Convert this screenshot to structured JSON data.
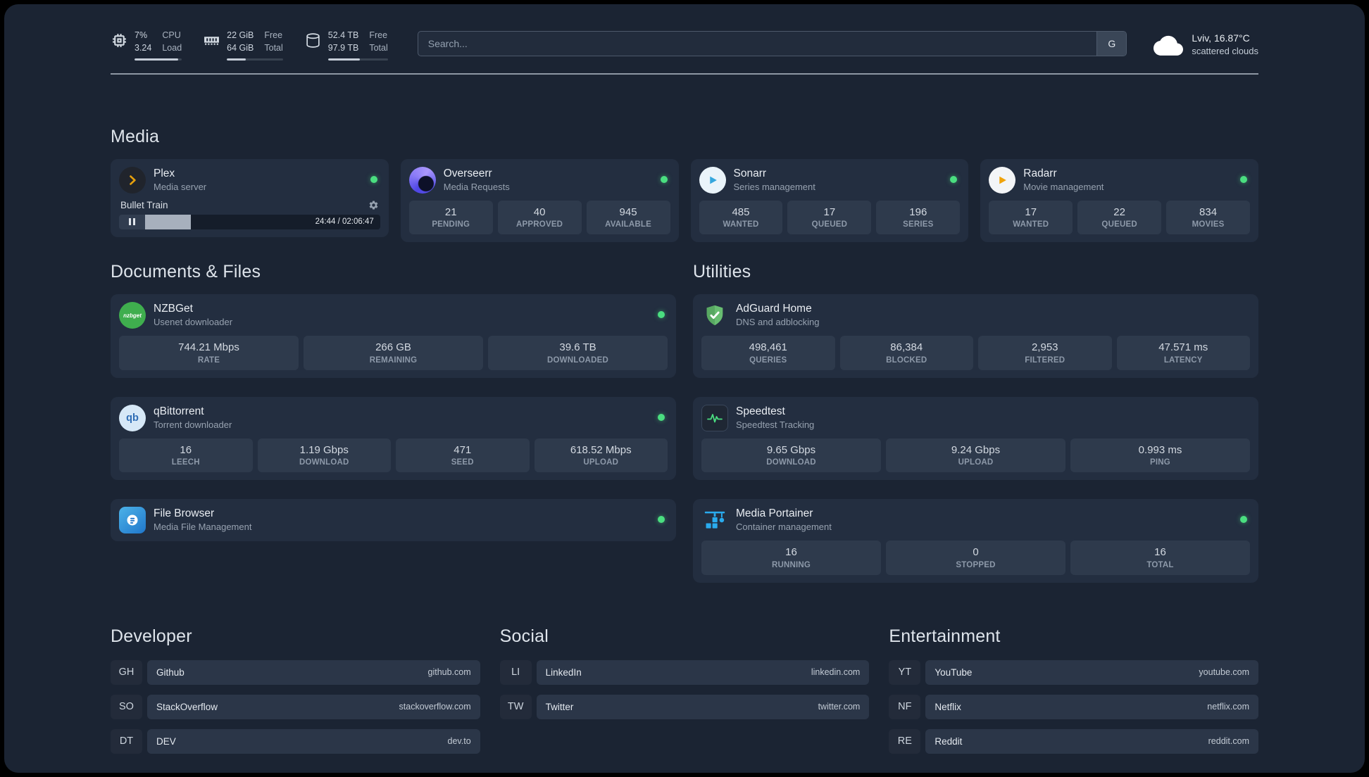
{
  "topbar": {
    "cpu": {
      "percent": "7%",
      "load": "3.24",
      "label_top": "CPU",
      "label_bottom": "Load",
      "bar_pct": 93
    },
    "memory": {
      "free": "22 GiB",
      "total": "64 GiB",
      "label_top": "Free",
      "label_bottom": "Total",
      "bar_pct": 34
    },
    "disk": {
      "free": "52.4 TB",
      "total": "97.9 TB",
      "label_top": "Free",
      "label_bottom": "Total",
      "bar_pct": 53
    },
    "search": {
      "placeholder": "Search...",
      "engine_label": "G"
    },
    "weather": {
      "location": "Lviv, 16.87°C",
      "condition": "scattered clouds"
    }
  },
  "sections": {
    "media": "Media",
    "documents": "Documents & Files",
    "utilities": "Utilities",
    "developer": "Developer",
    "social": "Social",
    "entertainment": "Entertainment"
  },
  "services": {
    "plex": {
      "name": "Plex",
      "desc": "Media server",
      "now_playing": {
        "title": "Bullet Train",
        "time": "24:44 / 02:06:47",
        "progress_pct": 19.5
      }
    },
    "overseerr": {
      "name": "Overseerr",
      "desc": "Media Requests",
      "stats": [
        {
          "value": "21",
          "label": "PENDING"
        },
        {
          "value": "40",
          "label": "APPROVED"
        },
        {
          "value": "945",
          "label": "AVAILABLE"
        }
      ]
    },
    "sonarr": {
      "name": "Sonarr",
      "desc": "Series management",
      "stats": [
        {
          "value": "485",
          "label": "WANTED"
        },
        {
          "value": "17",
          "label": "QUEUED"
        },
        {
          "value": "196",
          "label": "SERIES"
        }
      ]
    },
    "radarr": {
      "name": "Radarr",
      "desc": "Movie management",
      "stats": [
        {
          "value": "17",
          "label": "WANTED"
        },
        {
          "value": "22",
          "label": "QUEUED"
        },
        {
          "value": "834",
          "label": "MOVIES"
        }
      ]
    },
    "nzbget": {
      "name": "NZBGet",
      "desc": "Usenet downloader",
      "icon_text": "nzbget",
      "stats": [
        {
          "value": "744.21 Mbps",
          "label": "RATE"
        },
        {
          "value": "266 GB",
          "label": "REMAINING"
        },
        {
          "value": "39.6 TB",
          "label": "DOWNLOADED"
        }
      ]
    },
    "qbittorrent": {
      "name": "qBittorrent",
      "desc": "Torrent downloader",
      "icon_text": "qb",
      "stats": [
        {
          "value": "16",
          "label": "LEECH"
        },
        {
          "value": "1.19 Gbps",
          "label": "DOWNLOAD"
        },
        {
          "value": "471",
          "label": "SEED"
        },
        {
          "value": "618.52 Mbps",
          "label": "UPLOAD"
        }
      ]
    },
    "filebrowser": {
      "name": "File Browser",
      "desc": "Media File Management"
    },
    "adguard": {
      "name": "AdGuard Home",
      "desc": "DNS and adblocking",
      "stats": [
        {
          "value": "498,461",
          "label": "QUERIES"
        },
        {
          "value": "86,384",
          "label": "BLOCKED"
        },
        {
          "value": "2,953",
          "label": "FILTERED"
        },
        {
          "value": "47.571 ms",
          "label": "LATENCY"
        }
      ]
    },
    "speedtest": {
      "name": "Speedtest",
      "desc": "Speedtest Tracking",
      "stats": [
        {
          "value": "9.65 Gbps",
          "label": "DOWNLOAD"
        },
        {
          "value": "9.24 Gbps",
          "label": "UPLOAD"
        },
        {
          "value": "0.993 ms",
          "label": "PING"
        }
      ]
    },
    "portainer": {
      "name": "Media Portainer",
      "desc": "Container management",
      "stats": [
        {
          "value": "16",
          "label": "RUNNING"
        },
        {
          "value": "0",
          "label": "STOPPED"
        },
        {
          "value": "16",
          "label": "TOTAL"
        }
      ]
    }
  },
  "bookmarks": {
    "developer": [
      {
        "abbr": "GH",
        "name": "Github",
        "domain": "github.com"
      },
      {
        "abbr": "SO",
        "name": "StackOverflow",
        "domain": "stackoverflow.com"
      },
      {
        "abbr": "DT",
        "name": "DEV",
        "domain": "dev.to"
      }
    ],
    "social": [
      {
        "abbr": "LI",
        "name": "LinkedIn",
        "domain": "linkedin.com"
      },
      {
        "abbr": "TW",
        "name": "Twitter",
        "domain": "twitter.com"
      }
    ],
    "entertainment": [
      {
        "abbr": "YT",
        "name": "YouTube",
        "domain": "youtube.com"
      },
      {
        "abbr": "NF",
        "name": "Netflix",
        "domain": "netflix.com"
      },
      {
        "abbr": "RE",
        "name": "Reddit",
        "domain": "reddit.com"
      }
    ]
  },
  "colors": {
    "status_ok": "#4ade80",
    "background": "#1b2433",
    "card": "#232e40",
    "stat_box": "#2e3a4c",
    "plex_accent": "#e5a00d"
  }
}
